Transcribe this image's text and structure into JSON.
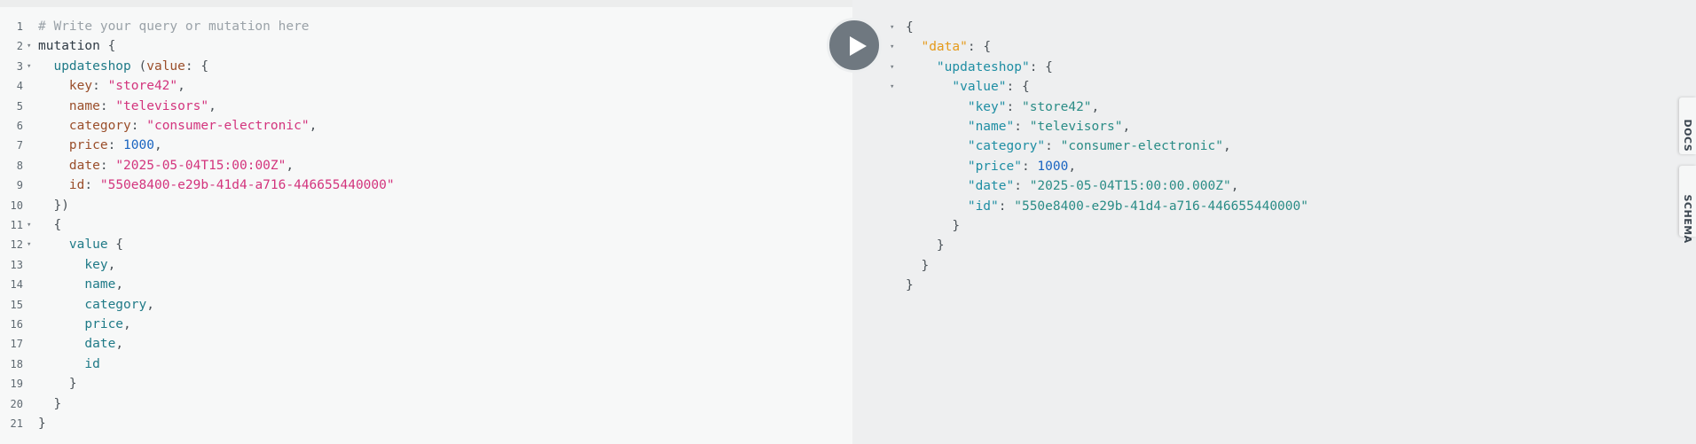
{
  "editor": {
    "line_numbers": [
      "1",
      "2",
      "3",
      "4",
      "5",
      "6",
      "7",
      "8",
      "9",
      "10",
      "11",
      "12",
      "13",
      "14",
      "15",
      "16",
      "17",
      "18",
      "19",
      "20",
      "21"
    ],
    "lines": [
      [
        {
          "t": "# Write your query or mutation here",
          "c": "comment"
        }
      ],
      [
        {
          "t": "mutation",
          "c": "kw"
        },
        {
          "t": " {",
          "c": "punct"
        }
      ],
      [
        {
          "t": "  updateshop",
          "c": "def"
        },
        {
          "t": " (",
          "c": "punct"
        },
        {
          "t": "value",
          "c": "attr"
        },
        {
          "t": ": {",
          "c": "punct"
        }
      ],
      [
        {
          "t": "    key",
          "c": "attr"
        },
        {
          "t": ": ",
          "c": "punct"
        },
        {
          "t": "\"store42\"",
          "c": "str"
        },
        {
          "t": ",",
          "c": "punct"
        }
      ],
      [
        {
          "t": "    name",
          "c": "attr"
        },
        {
          "t": ": ",
          "c": "punct"
        },
        {
          "t": "\"televisors\"",
          "c": "str"
        },
        {
          "t": ",",
          "c": "punct"
        }
      ],
      [
        {
          "t": "    category",
          "c": "attr"
        },
        {
          "t": ": ",
          "c": "punct"
        },
        {
          "t": "\"consumer-electronic\"",
          "c": "str"
        },
        {
          "t": ",",
          "c": "punct"
        }
      ],
      [
        {
          "t": "    price",
          "c": "attr"
        },
        {
          "t": ": ",
          "c": "punct"
        },
        {
          "t": "1000",
          "c": "num"
        },
        {
          "t": ",",
          "c": "punct"
        }
      ],
      [
        {
          "t": "    date",
          "c": "attr"
        },
        {
          "t": ": ",
          "c": "punct"
        },
        {
          "t": "\"2025-05-04T15:00:00Z\"",
          "c": "str"
        },
        {
          "t": ",",
          "c": "punct"
        }
      ],
      [
        {
          "t": "    id",
          "c": "attr"
        },
        {
          "t": ": ",
          "c": "punct"
        },
        {
          "t": "\"550e8400-e29b-41d4-a716-446655440000\"",
          "c": "str"
        }
      ],
      [
        {
          "t": "  })",
          "c": "punct"
        }
      ],
      [
        {
          "t": "  {",
          "c": "punct"
        }
      ],
      [
        {
          "t": "    value",
          "c": "def"
        },
        {
          "t": " {",
          "c": "punct"
        }
      ],
      [
        {
          "t": "      key",
          "c": "def"
        },
        {
          "t": ",",
          "c": "punct"
        }
      ],
      [
        {
          "t": "      name",
          "c": "def"
        },
        {
          "t": ",",
          "c": "punct"
        }
      ],
      [
        {
          "t": "      category",
          "c": "def"
        },
        {
          "t": ",",
          "c": "punct"
        }
      ],
      [
        {
          "t": "      price",
          "c": "def"
        },
        {
          "t": ",",
          "c": "punct"
        }
      ],
      [
        {
          "t": "      date",
          "c": "def"
        },
        {
          "t": ",",
          "c": "punct"
        }
      ],
      [
        {
          "t": "      id",
          "c": "def"
        }
      ],
      [
        {
          "t": "    }",
          "c": "punct"
        }
      ],
      [
        {
          "t": "  }",
          "c": "punct"
        }
      ],
      [
        {
          "t": "}",
          "c": "punct"
        }
      ]
    ],
    "fold_markers": [
      "2",
      "3",
      "11",
      "12"
    ]
  },
  "result": {
    "lines": [
      [
        {
          "t": "{",
          "c": "punct"
        }
      ],
      [
        {
          "t": "  ",
          "c": "punct"
        },
        {
          "t": "\"data\"",
          "c": "rdata"
        },
        {
          "t": ": {",
          "c": "punct"
        }
      ],
      [
        {
          "t": "    ",
          "c": "punct"
        },
        {
          "t": "\"updateshop\"",
          "c": "rkey"
        },
        {
          "t": ": {",
          "c": "punct"
        }
      ],
      [
        {
          "t": "      ",
          "c": "punct"
        },
        {
          "t": "\"value\"",
          "c": "rkey"
        },
        {
          "t": ": {",
          "c": "punct"
        }
      ],
      [
        {
          "t": "        ",
          "c": "punct"
        },
        {
          "t": "\"key\"",
          "c": "rkey"
        },
        {
          "t": ": ",
          "c": "punct"
        },
        {
          "t": "\"store42\"",
          "c": "rstr"
        },
        {
          "t": ",",
          "c": "punct"
        }
      ],
      [
        {
          "t": "        ",
          "c": "punct"
        },
        {
          "t": "\"name\"",
          "c": "rkey"
        },
        {
          "t": ": ",
          "c": "punct"
        },
        {
          "t": "\"televisors\"",
          "c": "rstr"
        },
        {
          "t": ",",
          "c": "punct"
        }
      ],
      [
        {
          "t": "        ",
          "c": "punct"
        },
        {
          "t": "\"category\"",
          "c": "rkey"
        },
        {
          "t": ": ",
          "c": "punct"
        },
        {
          "t": "\"consumer-electronic\"",
          "c": "rstr"
        },
        {
          "t": ",",
          "c": "punct"
        }
      ],
      [
        {
          "t": "        ",
          "c": "punct"
        },
        {
          "t": "\"price\"",
          "c": "rkey"
        },
        {
          "t": ": ",
          "c": "punct"
        },
        {
          "t": "1000",
          "c": "rnum"
        },
        {
          "t": ",",
          "c": "punct"
        }
      ],
      [
        {
          "t": "        ",
          "c": "punct"
        },
        {
          "t": "\"date\"",
          "c": "rkey"
        },
        {
          "t": ": ",
          "c": "punct"
        },
        {
          "t": "\"2025-05-04T15:00:00.000Z\"",
          "c": "rstr"
        },
        {
          "t": ",",
          "c": "punct"
        }
      ],
      [
        {
          "t": "        ",
          "c": "punct"
        },
        {
          "t": "\"id\"",
          "c": "rkey"
        },
        {
          "t": ": ",
          "c": "punct"
        },
        {
          "t": "\"550e8400-e29b-41d4-a716-446655440000\"",
          "c": "rstr"
        }
      ],
      [
        {
          "t": "      }",
          "c": "punct"
        }
      ],
      [
        {
          "t": "    }",
          "c": "punct"
        }
      ],
      [
        {
          "t": "  }",
          "c": "punct"
        }
      ],
      [
        {
          "t": "}",
          "c": "punct"
        }
      ]
    ],
    "fold_lines": [
      "1",
      "2",
      "3",
      "4"
    ]
  },
  "toolbar": {
    "run_icon": "play-icon"
  },
  "side_tabs": {
    "docs_label": "DOCS",
    "schema_label": "SCHEMA"
  }
}
